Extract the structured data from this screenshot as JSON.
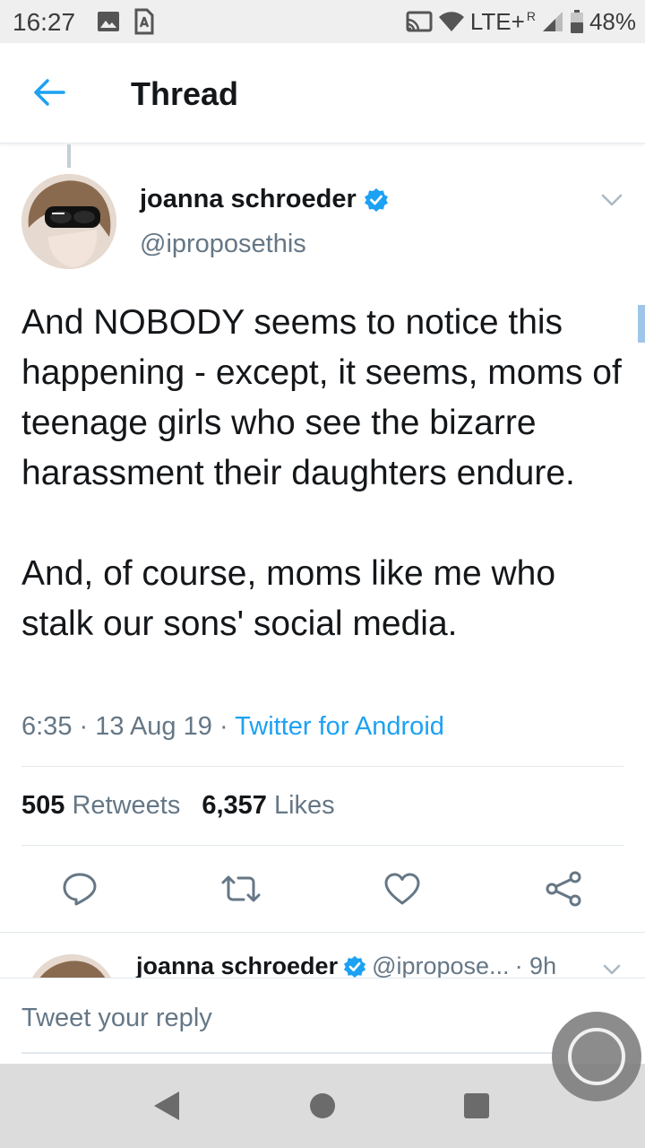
{
  "status_bar": {
    "time": "16:27",
    "network": "LTE+",
    "roaming": "R",
    "battery": "48%",
    "icons": [
      "image-icon",
      "sim-icon",
      "cast-icon",
      "wifi-icon",
      "signal-icon",
      "battery-icon"
    ]
  },
  "header": {
    "title": "Thread",
    "back_icon": "arrow-left-icon"
  },
  "tweet": {
    "name": "joanna schroeder",
    "handle": "@iproposethis",
    "text": "And NOBODY seems to notice this happening - except, it seems, moms of teenage girls who see the bizarre harassment their daughters endure.\n\nAnd, of course, moms like me who stalk our sons' social media.",
    "time": "6:35",
    "date": "13 Aug 19",
    "separator": "·",
    "source": "Twitter for Android",
    "retweets_count": "505",
    "retweets_label": "Retweets",
    "likes_count": "6,357",
    "likes_label": "Likes",
    "actions": [
      "reply-icon",
      "retweet-icon",
      "like-icon",
      "share-icon"
    ]
  },
  "next_tweet": {
    "name": "joanna schroeder",
    "handle": "@ipropose...",
    "age": "· 9h"
  },
  "reply": {
    "placeholder": "Tweet your reply"
  },
  "colors": {
    "accent": "#1da1f2",
    "secondary_text": "#657786",
    "primary_text": "#14171a"
  }
}
